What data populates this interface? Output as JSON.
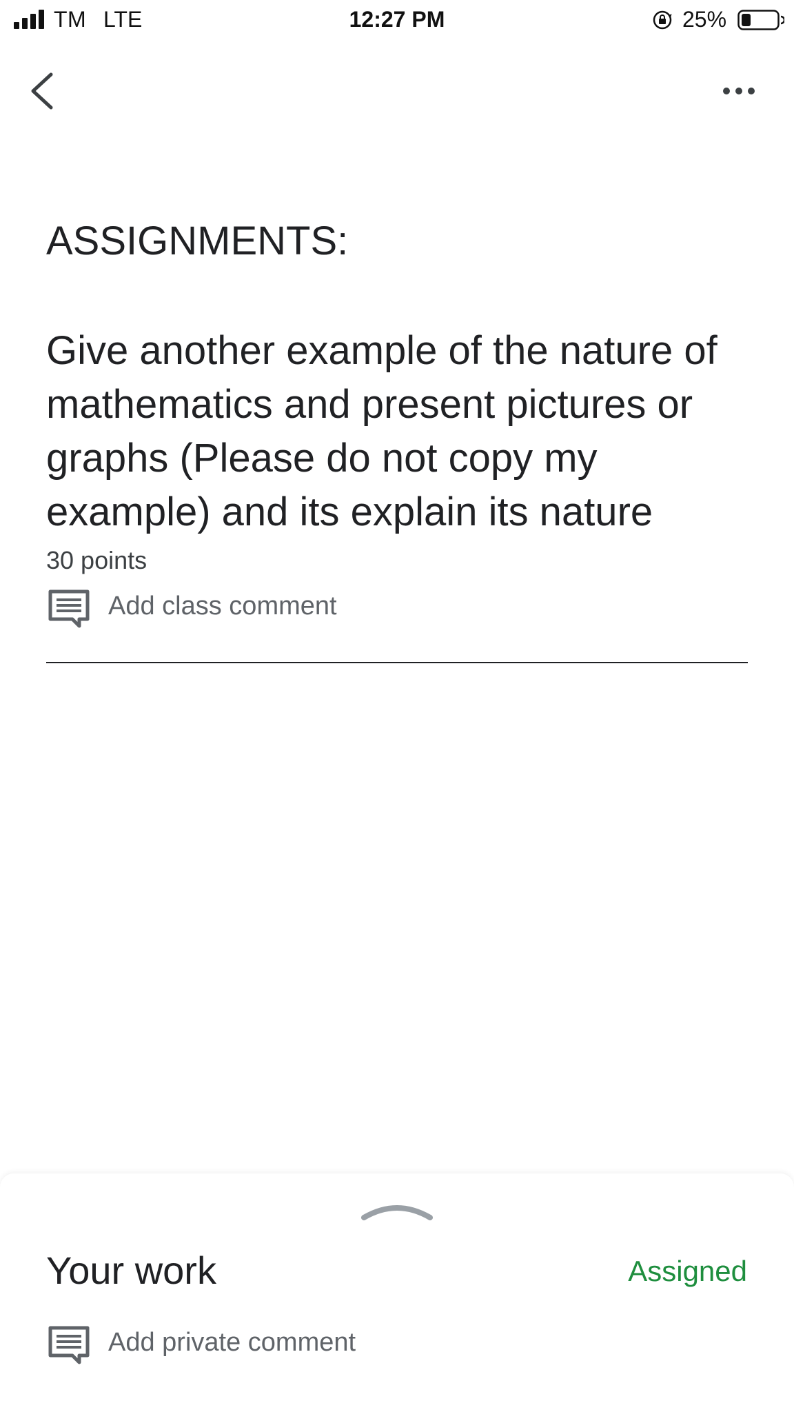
{
  "status_bar": {
    "carrier": "TM",
    "network": "LTE",
    "time": "12:27 PM",
    "battery": "25%",
    "icons": [
      "signal-icon",
      "orientation-lock-icon",
      "battery-icon"
    ]
  },
  "toolbar": {
    "back_icon": "chevron-left-icon",
    "more_icon": "more-horizontal-icon"
  },
  "assignment": {
    "heading": "ASSIGNMENTS:",
    "description": "Give another example of the nature of mathematics and present pictures or graphs (Please do not copy my example) and its explain its nature",
    "points": "30 points",
    "class_comment_label": "Add class comment",
    "class_comment_icon": "comment-icon"
  },
  "your_work": {
    "title": "Your work",
    "status": "Assigned",
    "private_comment_label": "Add private comment",
    "private_comment_icon": "comment-icon",
    "handle_icon": "chevron-up-icon"
  },
  "colors": {
    "status_assigned": "#1e8e3e",
    "text_primary": "#202124",
    "text_secondary": "#5f6368",
    "icon": "#5f6368"
  }
}
